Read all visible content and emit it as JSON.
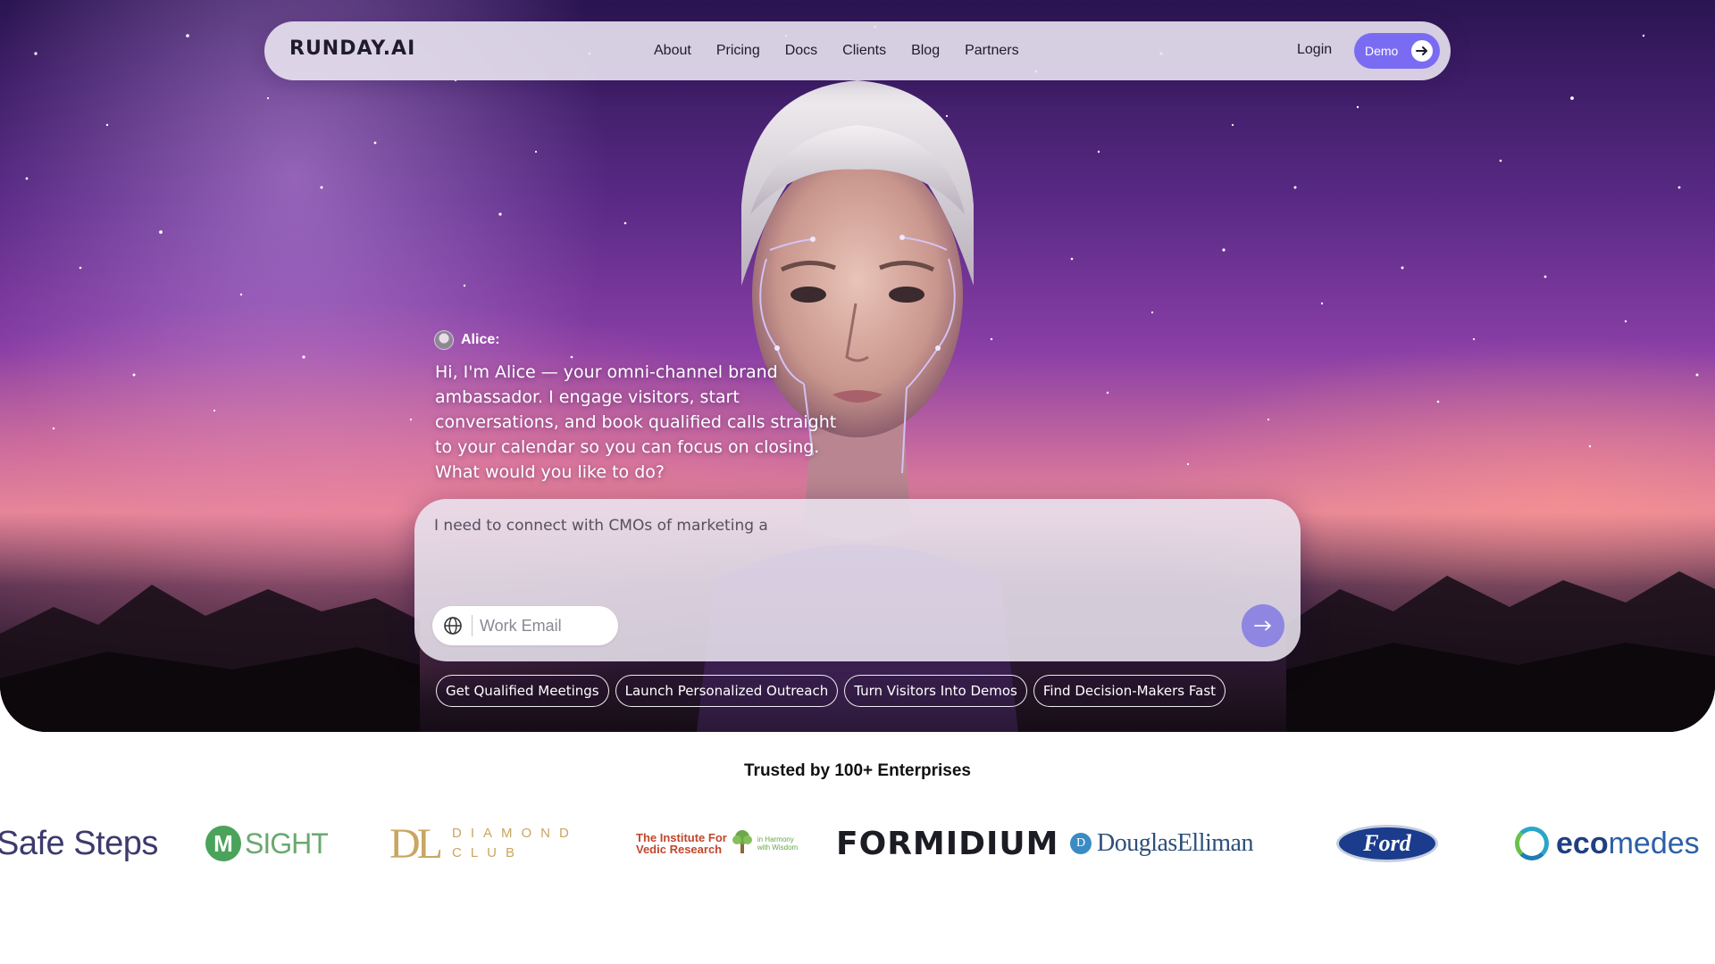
{
  "navbar": {
    "logo": "RUNDAY.AI",
    "links": [
      "About",
      "Pricing",
      "Docs",
      "Clients",
      "Blog",
      "Partners"
    ],
    "login_label": "Login",
    "demo_label": "Demo"
  },
  "assistant": {
    "name": "Alice:",
    "message": "Hi, I'm Alice — your omni-channel brand ambassador. I engage visitors, start conversations, and book qualified calls straight to your calendar so you can focus on closing. What would you like to do?"
  },
  "chat": {
    "input_value": "I need to connect with CMOs of marketing a",
    "email_placeholder": "Work Email"
  },
  "suggestions": [
    "Get Qualified Meetings",
    "Launch Personalized Outreach",
    "Turn Visitors Into Demos",
    "Find Decision-Makers Fast"
  ],
  "trusted": {
    "heading": "Trusted by 100+ Enterprises",
    "logos": {
      "safe_steps": "Safe Steps",
      "msight_m": "M",
      "msight_text": "SIGHT",
      "diamond_mark": "DL",
      "diamond_line1": "DIAMOND",
      "diamond_line2": "CLUB",
      "ivr_line1": "The Institute For",
      "ivr_line2": "Vedic Research",
      "ivr_tag1": "in Harmony",
      "ivr_tag2": "with Wisdom",
      "formidium": "FORMIDIUM",
      "douglas_mark": "D",
      "douglas": "DouglasElliman",
      "ford": "Ford",
      "eco_a": "eco",
      "eco_b": "medes"
    }
  },
  "colors": {
    "accent": "#7a6cf2",
    "send_button": "#8f86e2"
  }
}
